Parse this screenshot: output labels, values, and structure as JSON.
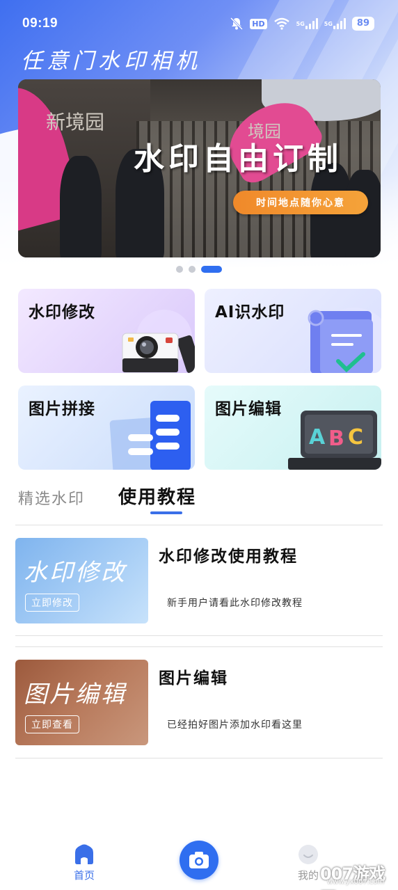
{
  "status_bar": {
    "time": "09:19",
    "hd_badge": "HD",
    "net_1": "5G",
    "net_2": "5G",
    "battery": "89"
  },
  "app": {
    "title": "任意门水印相机"
  },
  "banner": {
    "headline": "水印自由订制",
    "pill_text": "时间地点随你心意",
    "photo_sign_1": "新境园",
    "photo_sign_2": "境园",
    "active_slide": 3,
    "slide_count": 3
  },
  "feature_cards": [
    {
      "label": "水印修改",
      "icon": "camera-icon"
    },
    {
      "label": "AI识水印",
      "icon": "document-check-icon"
    },
    {
      "label": "图片拼接",
      "icon": "stack-icon"
    },
    {
      "label": "图片编辑",
      "icon": "abc-keyboard-icon"
    }
  ],
  "tabs": [
    {
      "label": "精选水印",
      "active": false
    },
    {
      "label": "使用教程",
      "active": true
    }
  ],
  "tutorials": [
    {
      "thumb_big": "水印修改",
      "thumb_small": "立即修改",
      "title": "水印修改使用教程",
      "desc": "新手用户请看此水印修改教程"
    },
    {
      "thumb_big": "图片编辑",
      "thumb_small": "立即查看",
      "title": "图片编辑",
      "desc": "已经拍好图片添加水印看这里"
    }
  ],
  "bottom_nav": {
    "home_label": "首页",
    "mine_label": "我的",
    "camera_icon": "camera-icon"
  },
  "watermark": {
    "site": "007游戏网",
    "url": "www.yx007.com"
  },
  "colors": {
    "accent": "#2f6ef0",
    "pill": "#f0892a"
  }
}
